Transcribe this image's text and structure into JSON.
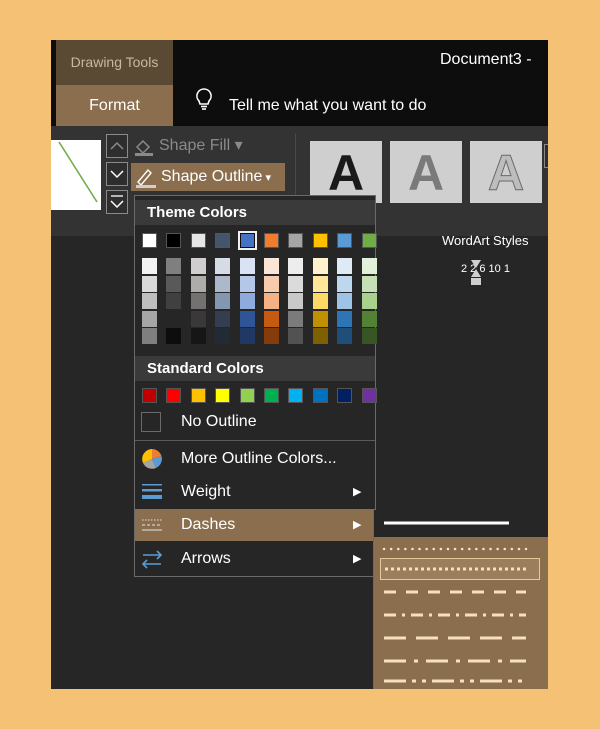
{
  "window": {
    "context_tab": "Drawing Tools",
    "document_title": "Document3  -",
    "active_tab": "Format",
    "tell_me": "Tell me what you want to do"
  },
  "ribbon": {
    "shape_fill": "Shape Fill",
    "shape_outline": "Shape Outline",
    "wordart_letter": "A",
    "wordart_group": "WordArt Styles",
    "ruler_text": "2 2  6  10  1"
  },
  "menu": {
    "theme_colors_label": "Theme Colors",
    "theme_colors": [
      "#ffffff",
      "#000000",
      "#e7e6e6",
      "#44546a",
      "#4472c4",
      "#ed7d31",
      "#a5a5a5",
      "#ffc000",
      "#5b9bd5",
      "#70ad47"
    ],
    "theme_shades": [
      [
        "#f2f2f2",
        "#d9d9d9",
        "#bfbfbf",
        "#a6a6a6",
        "#7f7f7f"
      ],
      [
        "#7f7f7f",
        "#595959",
        "#404040",
        "#262626",
        "#0d0d0d"
      ],
      [
        "#d0cece",
        "#aeabab",
        "#757171",
        "#3a3838",
        "#171616"
      ],
      [
        "#d6dce5",
        "#adb9ca",
        "#8497b0",
        "#333f50",
        "#222a35"
      ],
      [
        "#dae3f3",
        "#b4c7e7",
        "#8faadc",
        "#2f5597",
        "#1f3864"
      ],
      [
        "#fbe5d6",
        "#f8cbad",
        "#f4b183",
        "#c55a11",
        "#843c0c"
      ],
      [
        "#ededed",
        "#dbdbdb",
        "#c9c9c9",
        "#7b7b7b",
        "#525252"
      ],
      [
        "#fff2cc",
        "#ffe699",
        "#ffd966",
        "#bf9000",
        "#7f6000"
      ],
      [
        "#deebf7",
        "#bdd7ee",
        "#9dc3e6",
        "#2e75b6",
        "#1f4e79"
      ],
      [
        "#e2f0d9",
        "#c5e0b4",
        "#a9d18e",
        "#538135",
        "#375623"
      ]
    ],
    "standard_colors_label": "Standard Colors",
    "standard_colors": [
      "#c00000",
      "#ff0000",
      "#ffc000",
      "#ffff00",
      "#92d050",
      "#00b050",
      "#00b0f0",
      "#0070c0",
      "#002060",
      "#7030a0"
    ],
    "no_outline": "No Outline",
    "more_colors": "More Outline Colors...",
    "weight": "Weight",
    "dashes": "Dashes",
    "arrows": "Arrows"
  },
  "colors": {
    "accent": "#8a6e4e",
    "dash_line": "#f7e0bd",
    "window_bg": "#262626",
    "frame_bg": "#f5c175"
  }
}
